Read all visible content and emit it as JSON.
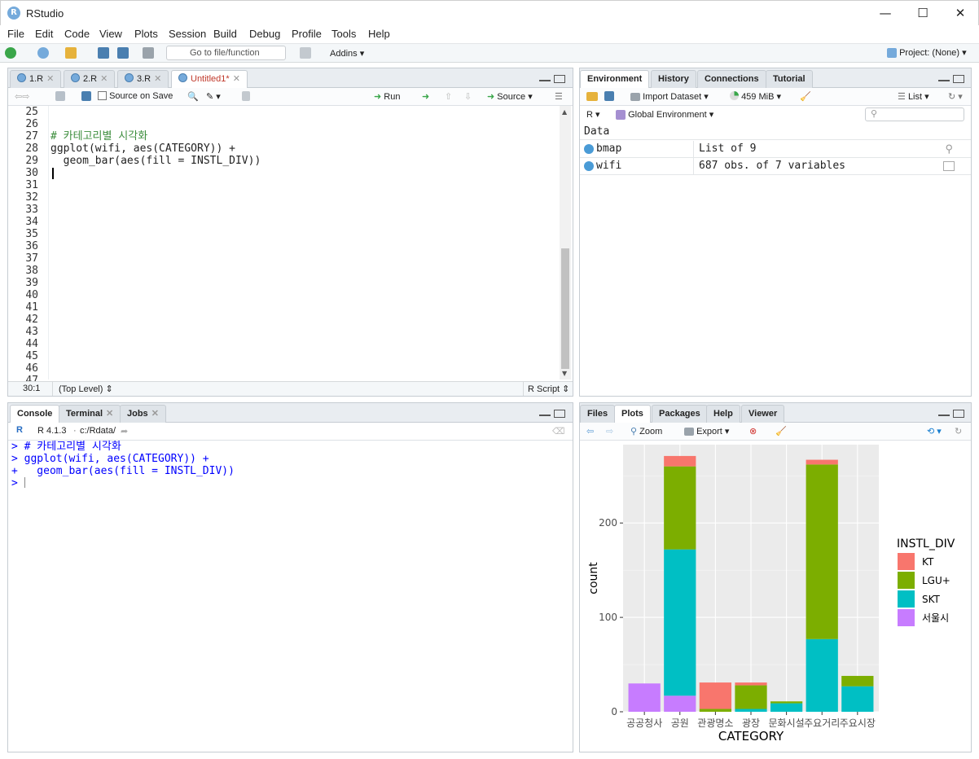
{
  "window": {
    "title": "RStudio",
    "app_icon": "R",
    "min": "—",
    "max": "☐",
    "close": "✕"
  },
  "menu": [
    "File",
    "Edit",
    "Code",
    "View",
    "Plots",
    "Session",
    "Build",
    "Debug",
    "Profile",
    "Tools",
    "Help"
  ],
  "toolbar": {
    "goto_placeholder": "Go to file/function",
    "addins": "Addins",
    "project": "Project: (None)"
  },
  "editor": {
    "tabs": [
      "1.R",
      "2.R",
      "3.R",
      "Untitled1*"
    ],
    "source_on_save": "Source on Save",
    "run": "Run",
    "source": "Source",
    "line_numbers": [
      "25",
      "26",
      "27",
      "28",
      "29",
      "30",
      "31",
      "32",
      "33",
      "34",
      "35",
      "36",
      "37",
      "38",
      "39",
      "40",
      "41",
      "42",
      "43",
      "44",
      "45",
      "46",
      "47"
    ],
    "lines": [
      "",
      "",
      "# 카테고리별 시각화",
      "ggplot(wifi, aes(CATEGORY)) +",
      "  geom_bar(aes(fill = INSTL_DIV))",
      "",
      "",
      "",
      "",
      "",
      "",
      "",
      "",
      "",
      "",
      "",
      "",
      "",
      "",
      "",
      "",
      "",
      ""
    ],
    "cursor_pos": "30:1",
    "scope": "(Top Level)",
    "file_type": "R Script"
  },
  "console": {
    "tabs": [
      "Console",
      "Terminal",
      "Jobs"
    ],
    "version": "R 4.1.3",
    "path": "c:/Rdata/",
    "lines": [
      "> # 카테고리별 시각화",
      "> ggplot(wifi, aes(CATEGORY)) +",
      "+   geom_bar(aes(fill = INSTL_DIV))",
      "> "
    ]
  },
  "environment": {
    "tabs": [
      "Environment",
      "History",
      "Connections",
      "Tutorial"
    ],
    "import_dataset": "Import Dataset",
    "memory": "459 MiB",
    "view_mode": "List",
    "language": "R",
    "scope": "Global Environment",
    "section": "Data",
    "rows": [
      {
        "name": "bmap",
        "value": "List of  9"
      },
      {
        "name": "wifi",
        "value": "687 obs. of 7 variables"
      }
    ]
  },
  "plots": {
    "tabs": [
      "Files",
      "Plots",
      "Packages",
      "Help",
      "Viewer"
    ],
    "zoom": "Zoom",
    "export": "Export"
  },
  "chart_data": {
    "type": "bar",
    "stacked": true,
    "categories": [
      "공공청사",
      "공원",
      "관광명소",
      "광장",
      "문화시설",
      "주요거리",
      "주요시장"
    ],
    "series": [
      {
        "name": "KT",
        "color": "#F8766D",
        "values": [
          0,
          11,
          28,
          3,
          0,
          5,
          0
        ]
      },
      {
        "name": "LGU+",
        "color": "#7CAE00",
        "values": [
          0,
          88,
          3,
          25,
          2,
          185,
          11
        ]
      },
      {
        "name": "SKT",
        "color": "#00BFC4",
        "values": [
          0,
          155,
          0,
          3,
          9,
          77,
          27
        ]
      },
      {
        "name": "서울시",
        "color": "#C77CFF",
        "values": [
          30,
          17,
          0,
          0,
          0,
          0,
          0
        ]
      }
    ],
    "xlabel": "CATEGORY",
    "ylabel": "count",
    "yticks": [
      0,
      100,
      200
    ],
    "ylim": [
      0,
      283
    ],
    "legend_title": "INSTL_DIV",
    "legend_position": "right",
    "grid": true
  }
}
